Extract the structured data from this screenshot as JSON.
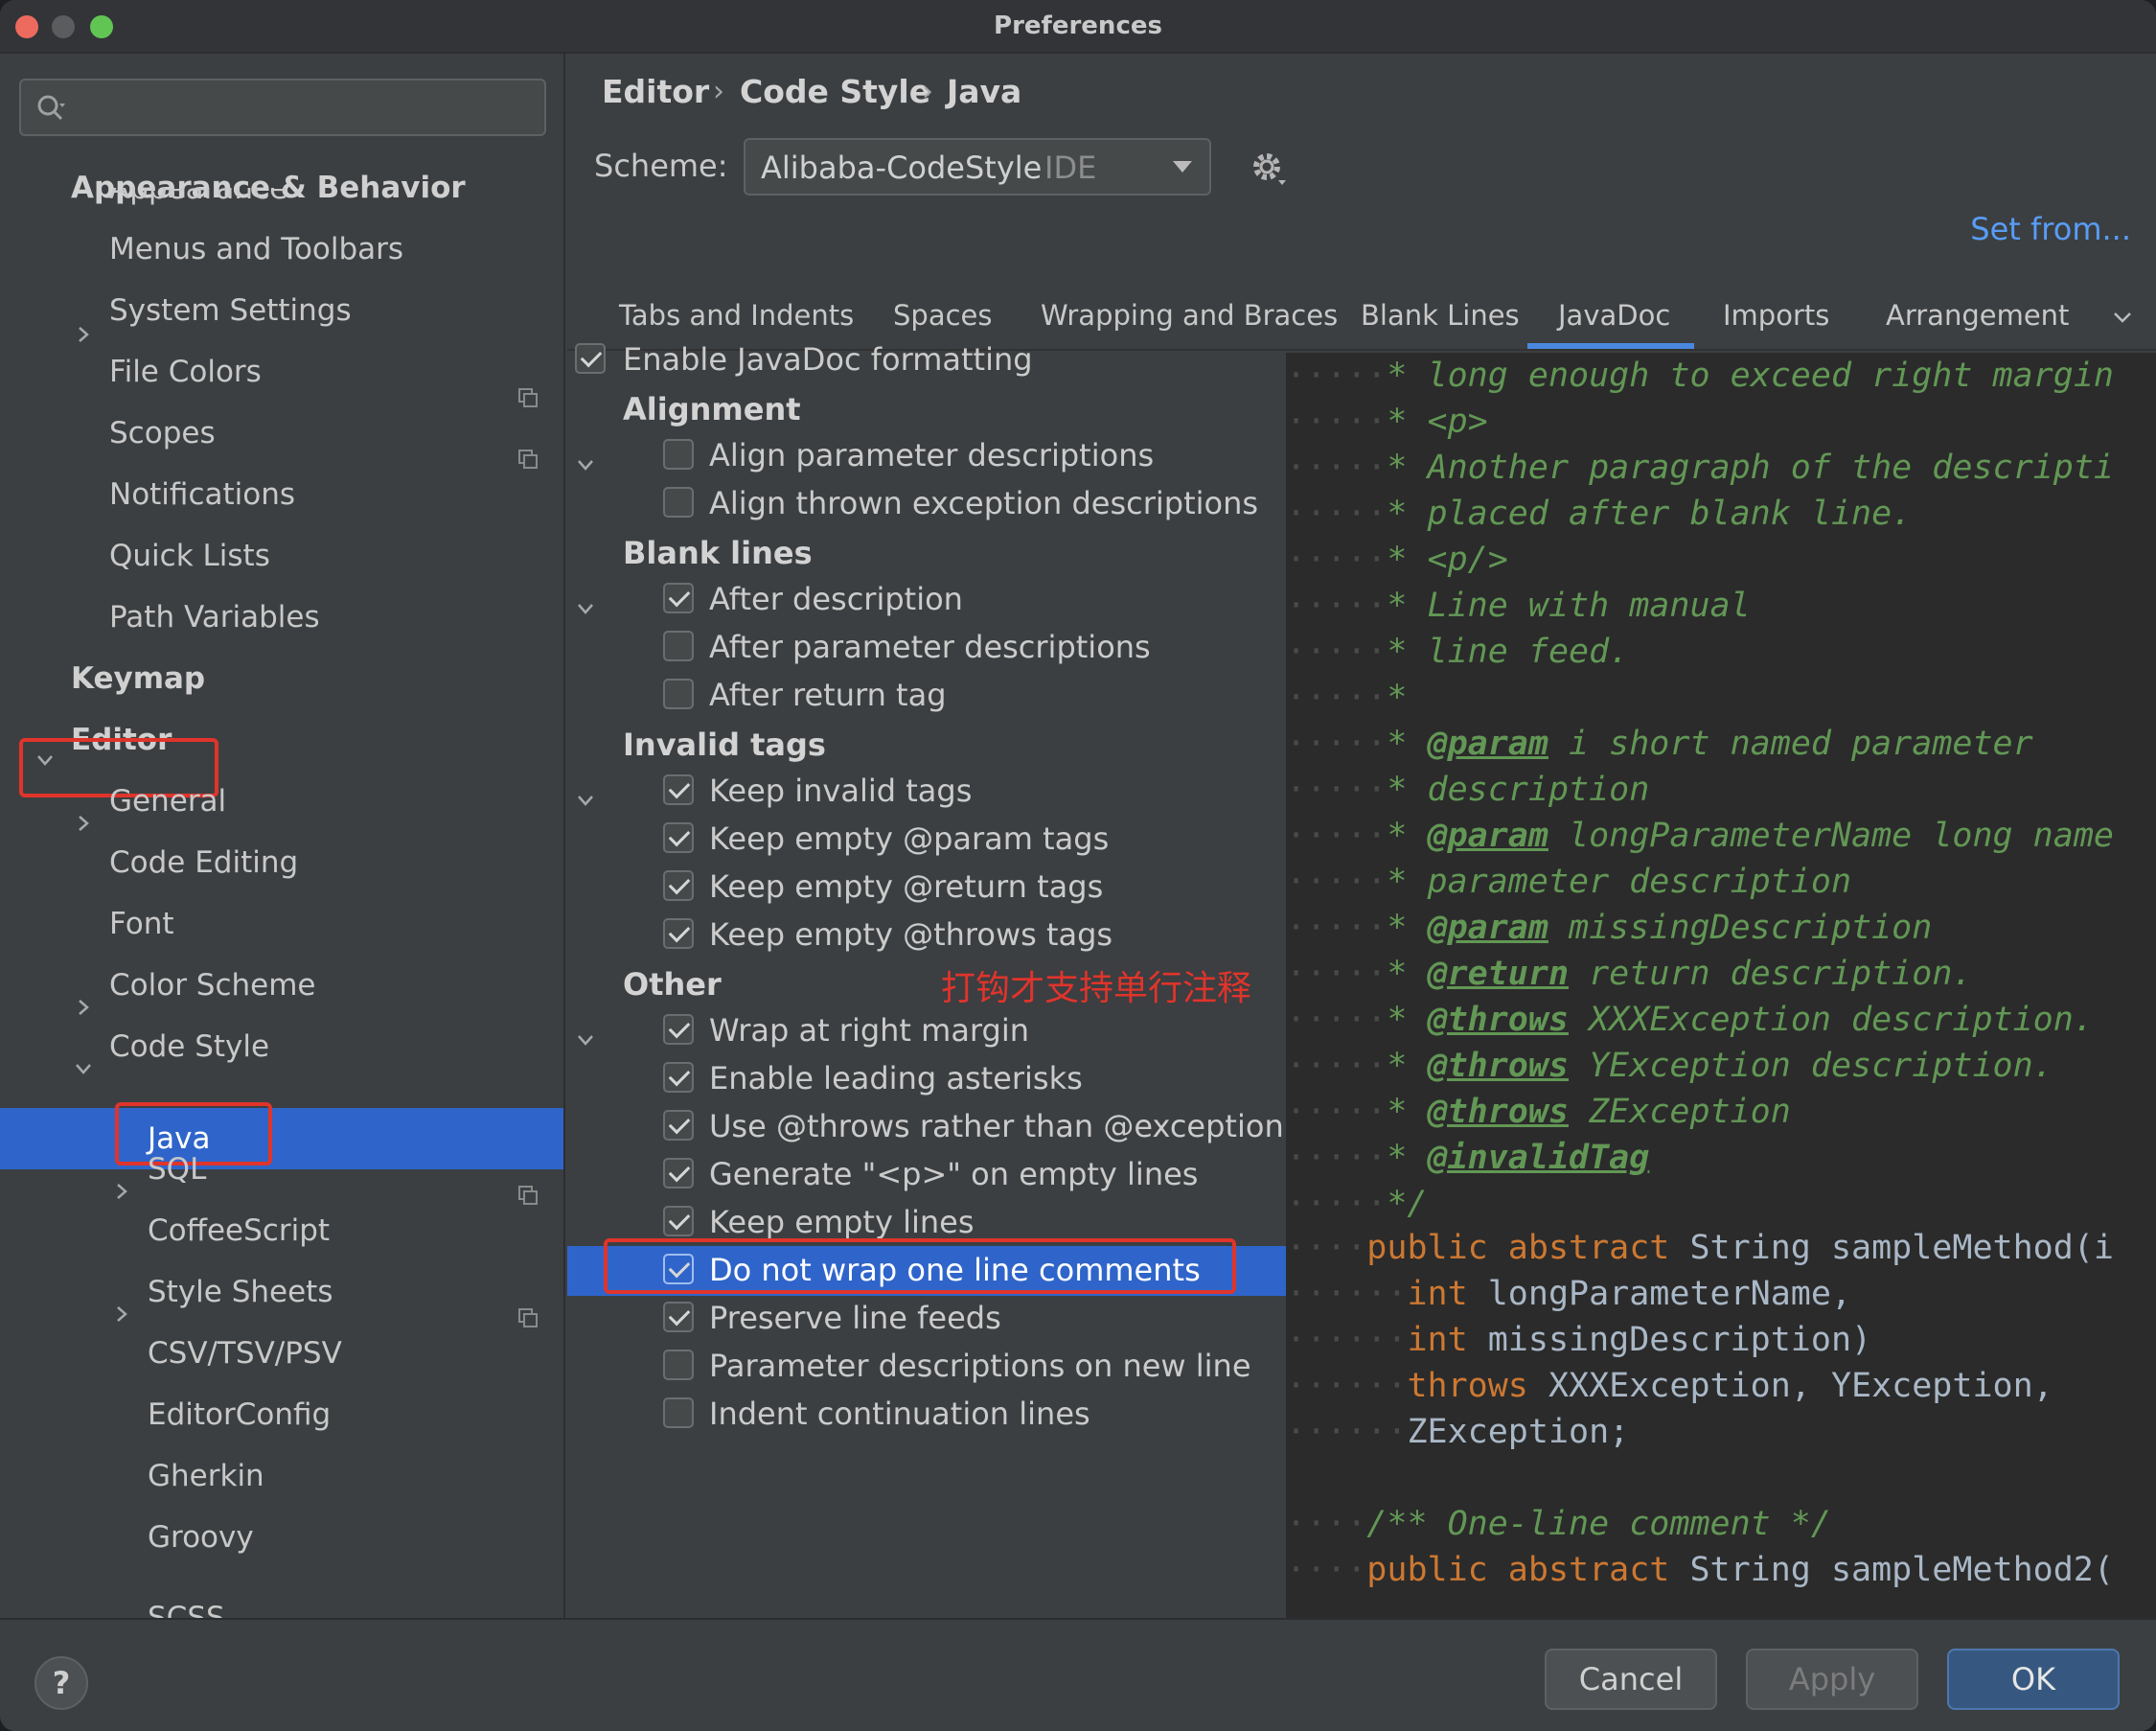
{
  "window": {
    "title": "Preferences"
  },
  "sidebar": {
    "items": [
      {
        "label": "Appearance & Behavior",
        "bold": true
      },
      {
        "label": "Appearance"
      },
      {
        "label": "Menus and Toolbars"
      },
      {
        "label": "System Settings"
      },
      {
        "label": "File Colors"
      },
      {
        "label": "Scopes"
      },
      {
        "label": "Notifications"
      },
      {
        "label": "Quick Lists"
      },
      {
        "label": "Path Variables"
      },
      {
        "label": "Keymap",
        "bold": true
      },
      {
        "label": "Editor",
        "bold": true
      },
      {
        "label": "General"
      },
      {
        "label": "Code Editing"
      },
      {
        "label": "Font"
      },
      {
        "label": "Color Scheme"
      },
      {
        "label": "Code Style"
      },
      {
        "label": "Java",
        "selected": true
      },
      {
        "label": "SQL"
      },
      {
        "label": "CoffeeScript"
      },
      {
        "label": "Style Sheets"
      },
      {
        "label": "CSV/TSV/PSV"
      },
      {
        "label": "EditorConfig"
      },
      {
        "label": "Gherkin"
      },
      {
        "label": "Groovy"
      },
      {
        "label": "SCSS"
      }
    ]
  },
  "breadcrumb": [
    "Editor",
    "Code Style",
    "Java"
  ],
  "scheme": {
    "label": "Scheme:",
    "value": "Alibaba-CodeStyle",
    "scope": "IDE"
  },
  "set_from": "Set from...",
  "tabs": [
    {
      "label": "Tabs and Indents"
    },
    {
      "label": "Spaces"
    },
    {
      "label": "Wrapping and Braces"
    },
    {
      "label": "Blank Lines"
    },
    {
      "label": "JavaDoc",
      "active": true
    },
    {
      "label": "Imports"
    },
    {
      "label": "Arrangement"
    }
  ],
  "javadoc": {
    "enable_label": "Enable JavaDoc formatting",
    "groups": {
      "alignment": "Alignment",
      "blank_lines": "Blank lines",
      "invalid_tags": "Invalid tags",
      "other": "Other"
    },
    "options": {
      "align_params": "Align parameter descriptions",
      "align_thrown": "Align thrown exception descriptions",
      "after_description": "After description",
      "after_param": "After parameter descriptions",
      "after_return": "After return tag",
      "keep_invalid": "Keep invalid tags",
      "keep_param": "Keep empty @param tags",
      "keep_return": "Keep empty @return tags",
      "keep_throws": "Keep empty @throws tags",
      "wrap_margin": "Wrap at right margin",
      "leading_asterisks": "Enable leading asterisks",
      "use_throws": "Use @throws rather than @exception",
      "generate_p": "Generate \"<p>\" on empty lines",
      "keep_empty_lines": "Keep empty lines",
      "no_wrap_one_line": "Do not wrap one line comments",
      "preserve_feeds": "Preserve line feeds",
      "param_new_line": "Parameter descriptions on new line",
      "indent_continuation": "Indent continuation lines"
    },
    "annotation": "打钩才支持单行注释"
  },
  "preview": {
    "lines": [
      {
        "pre": "* ",
        "text": "long enough to exceed right margin"
      },
      {
        "pre": "* ",
        "text": "<p>"
      },
      {
        "pre": "* ",
        "text": "Another paragraph of the descripti"
      },
      {
        "pre": "* ",
        "text": "placed after blank line."
      },
      {
        "pre": "* ",
        "text": "<p/>"
      },
      {
        "pre": "* ",
        "text": "Line with manual"
      },
      {
        "pre": "* ",
        "text": "line feed."
      },
      {
        "pre": "*",
        "text": ""
      },
      {
        "pre": "* ",
        "tag": "@param",
        "text": " i short named parameter"
      },
      {
        "pre": "* ",
        "text": "description"
      },
      {
        "pre": "* ",
        "tag": "@param",
        "text": " longParameterName long name"
      },
      {
        "pre": "* ",
        "text": "parameter description"
      },
      {
        "pre": "* ",
        "tag": "@param",
        "text": " missingDescription"
      },
      {
        "pre": "* ",
        "tag": "@return",
        "text": " return description."
      },
      {
        "pre": "* ",
        "tag": "@throws",
        "text": " XXXException description."
      },
      {
        "pre": "* ",
        "tag": "@throws",
        "text": " YException description."
      },
      {
        "pre": "* ",
        "tag": "@throws",
        "text": " ZException"
      },
      {
        "pre": "* ",
        "tag": "@invalidTag",
        "text": ""
      },
      {
        "pre": "*/",
        "text": ""
      }
    ],
    "code": {
      "line1_kw": "public abstract",
      "line1_rest": " String sampleMethod(i",
      "line2_kw": "int",
      "line2_rest": " longParameterName,",
      "line3_kw": "int",
      "line3_rest": " missingDescription)",
      "line4_kw": "throws",
      "line4_rest": " XXXException, YException,",
      "line5": "ZException;",
      "one_line_comment": "/** One-line comment */",
      "last_kw": "public abstract",
      "last_rest": " String sampleMethod2("
    }
  },
  "footer": {
    "help": "?",
    "cancel": "Cancel",
    "apply": "Apply",
    "ok": "OK"
  }
}
